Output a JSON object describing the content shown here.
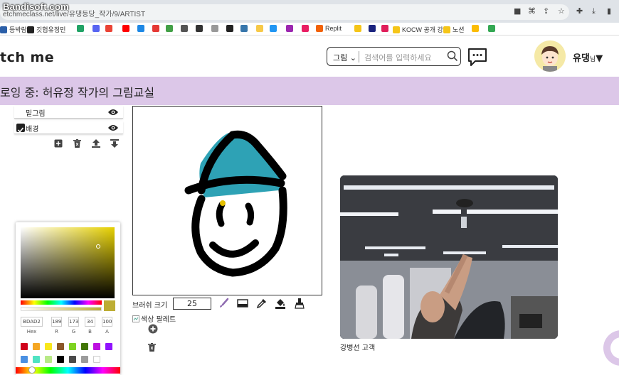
{
  "browser": {
    "watermark": "Bandisoft.com",
    "url": "etchmeclass.net/live/유댕등당_작가/9/ARTIST",
    "bookmarks": [
      {
        "label": "등박람회",
        "color": "#2b5fa8"
      },
      {
        "label": "깃헙유정민",
        "color": "#222222"
      },
      {
        "label": "",
        "color": "#21a366"
      },
      {
        "label": "",
        "color": "#5865f2"
      },
      {
        "label": "",
        "color": "#ea4335"
      },
      {
        "label": "",
        "color": "#ff0000"
      },
      {
        "label": "",
        "color": "#1e88e5"
      },
      {
        "label": "",
        "color": "#e53935"
      },
      {
        "label": "",
        "color": "#43a047"
      },
      {
        "label": "",
        "color": "#555555"
      },
      {
        "label": "",
        "color": "#333333"
      },
      {
        "label": "",
        "color": "#999999"
      },
      {
        "label": "",
        "color": "#222222"
      },
      {
        "label": "",
        "color": "#3776ab"
      },
      {
        "label": "",
        "color": "#f7c948"
      },
      {
        "label": "",
        "color": "#2196f3"
      },
      {
        "label": "",
        "color": "#9c27b0"
      },
      {
        "label": "",
        "color": "#e91e63"
      },
      {
        "label": "Replit",
        "color": "#f26207"
      },
      {
        "label": "",
        "color": "#f5c518"
      },
      {
        "label": "",
        "color": "#1a237e"
      },
      {
        "label": "",
        "color": "#e01e5a"
      },
      {
        "label": "KOCW 공개 강의",
        "color": "#f5c518"
      },
      {
        "label": "노션",
        "color": "#f5c518"
      },
      {
        "label": "",
        "color": "#fbbc04"
      },
      {
        "label": "",
        "color": "#34a853"
      }
    ]
  },
  "header": {
    "logo": "tch me",
    "search": {
      "category": "그림",
      "placeholder": "검색어를 입력하세요"
    },
    "user": {
      "name": "유댕",
      "suffix": "님"
    }
  },
  "banner": {
    "text": "로잉 중: 허유정 작가의 그림교실"
  },
  "layers": {
    "items": [
      {
        "label": "밑그림",
        "checked": false
      },
      {
        "label": "배경",
        "checked": true
      }
    ]
  },
  "brush": {
    "label": "브러쉬 크기",
    "size": "25"
  },
  "color_picker": {
    "current": "#bdad34",
    "fields": [
      {
        "label": "Hex",
        "value": "BDAD2"
      },
      {
        "label": "R",
        "value": "189"
      },
      {
        "label": "G",
        "value": "173"
      },
      {
        "label": "B",
        "value": "34"
      },
      {
        "label": "A",
        "value": "100"
      }
    ],
    "swatches": [
      "#d0021b",
      "#f5a623",
      "#f8e71c",
      "#8b572a",
      "#7ed321",
      "#417505",
      "#bd10e0",
      "#9013fe",
      "#4a90e2",
      "#50e3c2",
      "#b8e986",
      "#000000",
      "#4a4a4a",
      "#9b9b9b",
      "#ffffff"
    ]
  },
  "palette": {
    "alt_text": "색상 팔레트"
  },
  "video": {
    "caption": "강병선 고객"
  }
}
